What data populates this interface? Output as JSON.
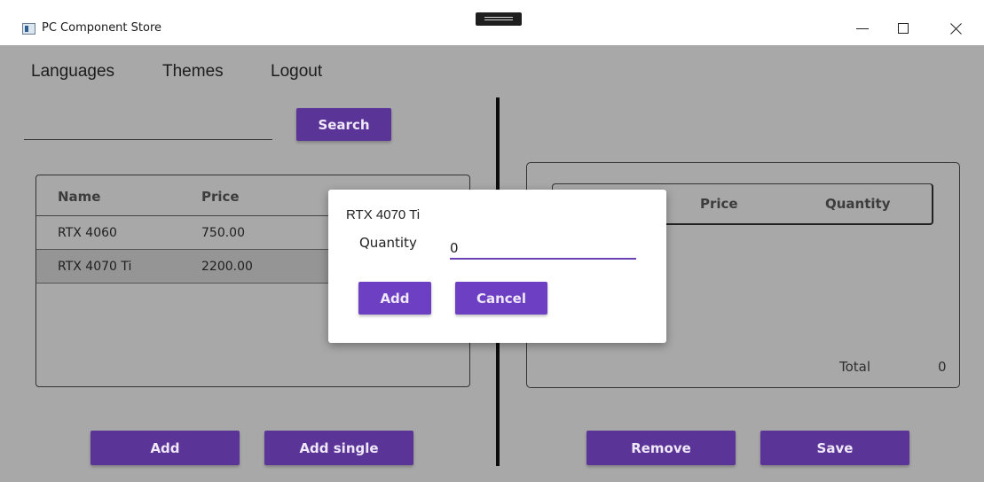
{
  "window": {
    "title": "PC Component Store"
  },
  "menu": {
    "items": [
      "Languages",
      "Themes",
      "Logout"
    ]
  },
  "search": {
    "input_value": "",
    "button_label": "Search"
  },
  "products": {
    "columns": [
      "Name",
      "Price"
    ],
    "rows": [
      {
        "name": "RTX 4060",
        "price": "750.00"
      },
      {
        "name": "RTX 4070 Ti",
        "price": "2200.00"
      }
    ],
    "selected_index": 1
  },
  "cart": {
    "columns": [
      "Price",
      "Quantity"
    ],
    "total_label": "Total",
    "total_value": "0"
  },
  "buttons": {
    "add": "Add",
    "add_single": "Add single",
    "remove": "Remove",
    "save": "Save"
  },
  "dialog": {
    "title": "RTX 4070 Ti",
    "quantity_label": "Quantity",
    "quantity_value": "0",
    "add_label": "Add",
    "cancel_label": "Cancel"
  },
  "colors": {
    "accent": "#5a3496",
    "dialog_accent": "#6d3fc2",
    "overlay": "#a8a8a8"
  },
  "icons": [
    "app-icon",
    "minimize-icon",
    "maximize-icon",
    "close-icon"
  ]
}
